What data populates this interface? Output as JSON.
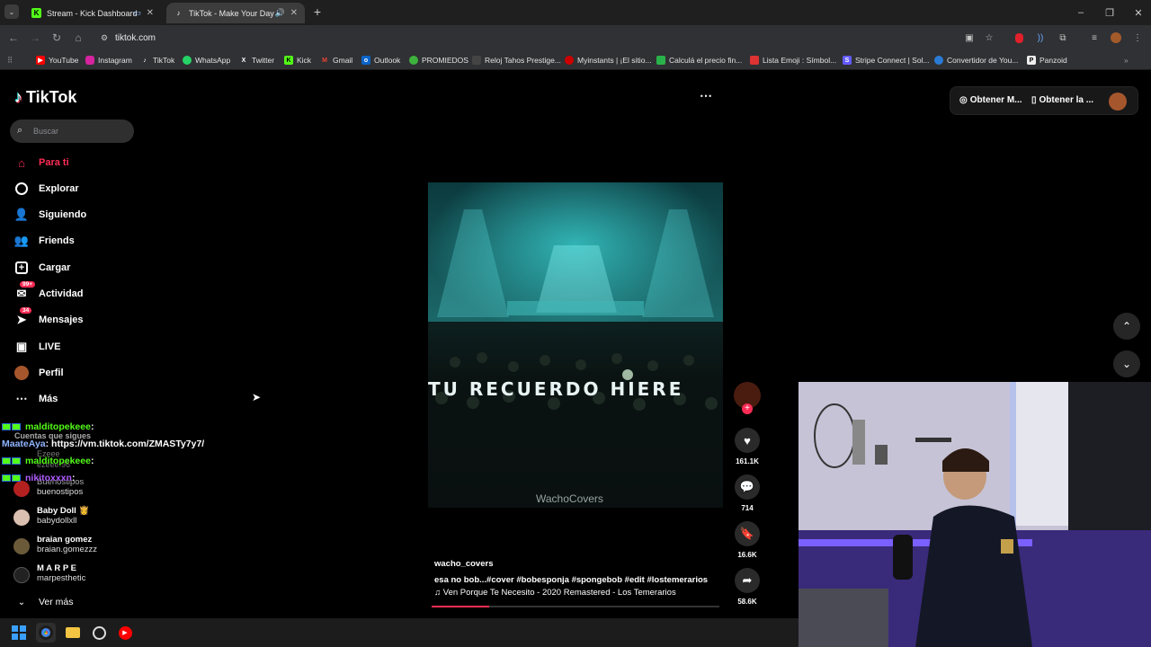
{
  "browser": {
    "tabs": [
      {
        "title": "Stream - Kick Dashboard",
        "active": false
      },
      {
        "title": "TikTok - Make Your Day",
        "active": true
      }
    ],
    "url": "tiktok.com",
    "bookmarks": [
      "YouTube",
      "Instagram",
      "TikTok",
      "WhatsApp",
      "Twitter",
      "Kick",
      "Gmail",
      "Outlook",
      "PROMIEDOS",
      "Reloj Tahos Prestige...",
      "Myinstants | ¡El sitio...",
      "Calculá el precio fin...",
      "Lista Emoji : Símbol...",
      "Stripe Connect | Sol...",
      "Convertidor de You...",
      "Panzoid"
    ]
  },
  "tiktok": {
    "logo": "TikTok",
    "search_placeholder": "Buscar",
    "nav": [
      {
        "label": "Para ti",
        "active": true
      },
      {
        "label": "Explorar"
      },
      {
        "label": "Siguiendo"
      },
      {
        "label": "Friends"
      },
      {
        "label": "Cargar"
      },
      {
        "label": "Actividad",
        "badge": "99+"
      },
      {
        "label": "Mensajes",
        "badge": "34"
      },
      {
        "label": "LIVE"
      },
      {
        "label": "Perfil"
      },
      {
        "label": "Más"
      }
    ],
    "following_title": "Cuentas que sigues",
    "following_first": "Ezeee",
    "following_first_handle": "ezeee.96",
    "accounts": [
      {
        "name": "Buenostipos",
        "handle": "buenostipos"
      },
      {
        "name": "Baby Doll 👸",
        "handle": "babydollxll"
      },
      {
        "name": "braian gomez",
        "handle": "braian.gomezzz"
      },
      {
        "name": "M A R P E",
        "handle": "marpesthetic"
      }
    ],
    "see_more": "Ver más",
    "top_buttons": [
      "Obtener M...",
      "Obtener la ..."
    ],
    "video": {
      "lyric": "TU RECUERDO HIERE",
      "watermark": "WachoCovers",
      "author": "wacho_covers",
      "caption": "esa no bob...#cover  #bobesponja  #spongebob  #edit  #lostemerarios",
      "music": "Ven Porque Te Necesito - 2020 Remastered - Los Temerarios",
      "likes": "161.1K",
      "comments": "714",
      "saves": "16.6K",
      "shares": "58.6K",
      "progress": 0.2
    }
  },
  "chat": [
    {
      "user": "malditopekeee",
      "text": " :",
      "color": "#53fc18"
    },
    {
      "user": "MaateAya",
      "text": " : https://vm.tiktok.com/ZMASTy7y7/",
      "color": "#8fb4ff"
    },
    {
      "user": "malditopekeee",
      "text": " : ",
      "color": "#53fc18"
    },
    {
      "user": "nikitoxxxn",
      "text": " : ",
      "color": "#b05cff"
    }
  ]
}
